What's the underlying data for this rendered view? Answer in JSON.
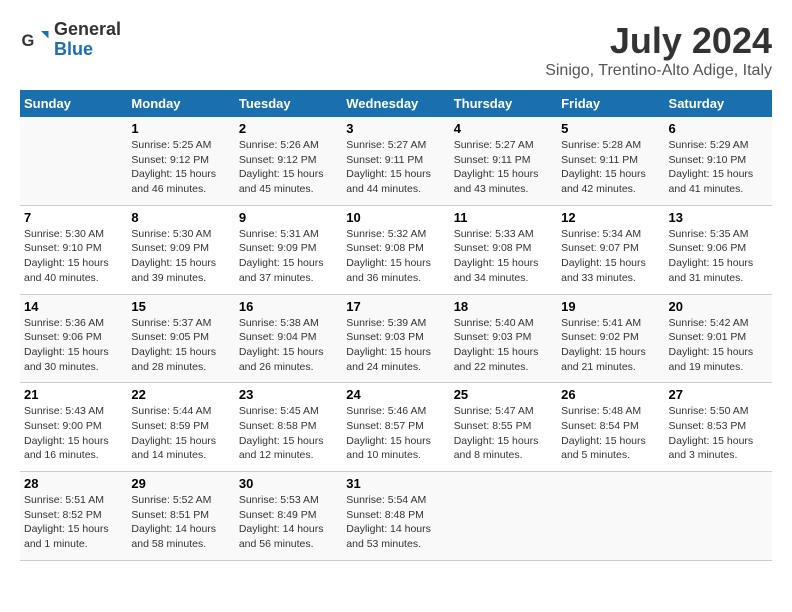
{
  "header": {
    "logo_general": "General",
    "logo_blue": "Blue",
    "title": "July 2024",
    "subtitle": "Sinigo, Trentino-Alto Adige, Italy"
  },
  "columns": [
    "Sunday",
    "Monday",
    "Tuesday",
    "Wednesday",
    "Thursday",
    "Friday",
    "Saturday"
  ],
  "weeks": [
    [
      {
        "day": "",
        "info": ""
      },
      {
        "day": "1",
        "info": "Sunrise: 5:25 AM\nSunset: 9:12 PM\nDaylight: 15 hours\nand 46 minutes."
      },
      {
        "day": "2",
        "info": "Sunrise: 5:26 AM\nSunset: 9:12 PM\nDaylight: 15 hours\nand 45 minutes."
      },
      {
        "day": "3",
        "info": "Sunrise: 5:27 AM\nSunset: 9:11 PM\nDaylight: 15 hours\nand 44 minutes."
      },
      {
        "day": "4",
        "info": "Sunrise: 5:27 AM\nSunset: 9:11 PM\nDaylight: 15 hours\nand 43 minutes."
      },
      {
        "day": "5",
        "info": "Sunrise: 5:28 AM\nSunset: 9:11 PM\nDaylight: 15 hours\nand 42 minutes."
      },
      {
        "day": "6",
        "info": "Sunrise: 5:29 AM\nSunset: 9:10 PM\nDaylight: 15 hours\nand 41 minutes."
      }
    ],
    [
      {
        "day": "7",
        "info": "Sunrise: 5:30 AM\nSunset: 9:10 PM\nDaylight: 15 hours\nand 40 minutes."
      },
      {
        "day": "8",
        "info": "Sunrise: 5:30 AM\nSunset: 9:09 PM\nDaylight: 15 hours\nand 39 minutes."
      },
      {
        "day": "9",
        "info": "Sunrise: 5:31 AM\nSunset: 9:09 PM\nDaylight: 15 hours\nand 37 minutes."
      },
      {
        "day": "10",
        "info": "Sunrise: 5:32 AM\nSunset: 9:08 PM\nDaylight: 15 hours\nand 36 minutes."
      },
      {
        "day": "11",
        "info": "Sunrise: 5:33 AM\nSunset: 9:08 PM\nDaylight: 15 hours\nand 34 minutes."
      },
      {
        "day": "12",
        "info": "Sunrise: 5:34 AM\nSunset: 9:07 PM\nDaylight: 15 hours\nand 33 minutes."
      },
      {
        "day": "13",
        "info": "Sunrise: 5:35 AM\nSunset: 9:06 PM\nDaylight: 15 hours\nand 31 minutes."
      }
    ],
    [
      {
        "day": "14",
        "info": "Sunrise: 5:36 AM\nSunset: 9:06 PM\nDaylight: 15 hours\nand 30 minutes."
      },
      {
        "day": "15",
        "info": "Sunrise: 5:37 AM\nSunset: 9:05 PM\nDaylight: 15 hours\nand 28 minutes."
      },
      {
        "day": "16",
        "info": "Sunrise: 5:38 AM\nSunset: 9:04 PM\nDaylight: 15 hours\nand 26 minutes."
      },
      {
        "day": "17",
        "info": "Sunrise: 5:39 AM\nSunset: 9:03 PM\nDaylight: 15 hours\nand 24 minutes."
      },
      {
        "day": "18",
        "info": "Sunrise: 5:40 AM\nSunset: 9:03 PM\nDaylight: 15 hours\nand 22 minutes."
      },
      {
        "day": "19",
        "info": "Sunrise: 5:41 AM\nSunset: 9:02 PM\nDaylight: 15 hours\nand 21 minutes."
      },
      {
        "day": "20",
        "info": "Sunrise: 5:42 AM\nSunset: 9:01 PM\nDaylight: 15 hours\nand 19 minutes."
      }
    ],
    [
      {
        "day": "21",
        "info": "Sunrise: 5:43 AM\nSunset: 9:00 PM\nDaylight: 15 hours\nand 16 minutes."
      },
      {
        "day": "22",
        "info": "Sunrise: 5:44 AM\nSunset: 8:59 PM\nDaylight: 15 hours\nand 14 minutes."
      },
      {
        "day": "23",
        "info": "Sunrise: 5:45 AM\nSunset: 8:58 PM\nDaylight: 15 hours\nand 12 minutes."
      },
      {
        "day": "24",
        "info": "Sunrise: 5:46 AM\nSunset: 8:57 PM\nDaylight: 15 hours\nand 10 minutes."
      },
      {
        "day": "25",
        "info": "Sunrise: 5:47 AM\nSunset: 8:55 PM\nDaylight: 15 hours\nand 8 minutes."
      },
      {
        "day": "26",
        "info": "Sunrise: 5:48 AM\nSunset: 8:54 PM\nDaylight: 15 hours\nand 5 minutes."
      },
      {
        "day": "27",
        "info": "Sunrise: 5:50 AM\nSunset: 8:53 PM\nDaylight: 15 hours\nand 3 minutes."
      }
    ],
    [
      {
        "day": "28",
        "info": "Sunrise: 5:51 AM\nSunset: 8:52 PM\nDaylight: 15 hours\nand 1 minute."
      },
      {
        "day": "29",
        "info": "Sunrise: 5:52 AM\nSunset: 8:51 PM\nDaylight: 14 hours\nand 58 minutes."
      },
      {
        "day": "30",
        "info": "Sunrise: 5:53 AM\nSunset: 8:49 PM\nDaylight: 14 hours\nand 56 minutes."
      },
      {
        "day": "31",
        "info": "Sunrise: 5:54 AM\nSunset: 8:48 PM\nDaylight: 14 hours\nand 53 minutes."
      },
      {
        "day": "",
        "info": ""
      },
      {
        "day": "",
        "info": ""
      },
      {
        "day": "",
        "info": ""
      }
    ]
  ]
}
